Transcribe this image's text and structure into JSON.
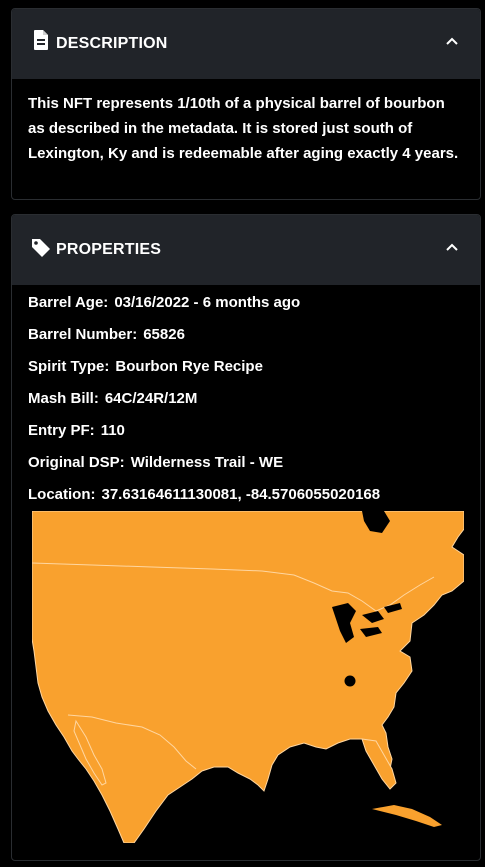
{
  "description": {
    "title": "DESCRIPTION",
    "icon": "document-icon",
    "text": "This NFT represents 1/10th of a physical barrel of bourbon as described in the metadata. It is stored just south of Lexington, Ky and is redeemable after aging exactly 4 years."
  },
  "properties": {
    "title": "PROPERTIES",
    "icon": "tag-icon",
    "items": [
      {
        "label": "Barrel Age:",
        "value": "03/16/2022 - 6 months ago"
      },
      {
        "label": "Barrel Number:",
        "value": "65826"
      },
      {
        "label": "Spirit Type:",
        "value": "Bourbon Rye Recipe"
      },
      {
        "label": "Mash Bill:",
        "value": "64C/24R/12M"
      },
      {
        "label": "Entry PF:",
        "value": "110"
      },
      {
        "label": "Original DSP:",
        "value": "Wilderness Trail - WE"
      },
      {
        "label": "Location:",
        "value": "37.63164611130081, -84.5706055020168"
      }
    ]
  },
  "map": {
    "land_color": "#f9a12e",
    "border_color": "#ffd6a0",
    "background_color": "#000000",
    "marker_color": "#000000"
  },
  "colors": {
    "header_bg": "#212429",
    "card_border": "#2a2d31"
  }
}
